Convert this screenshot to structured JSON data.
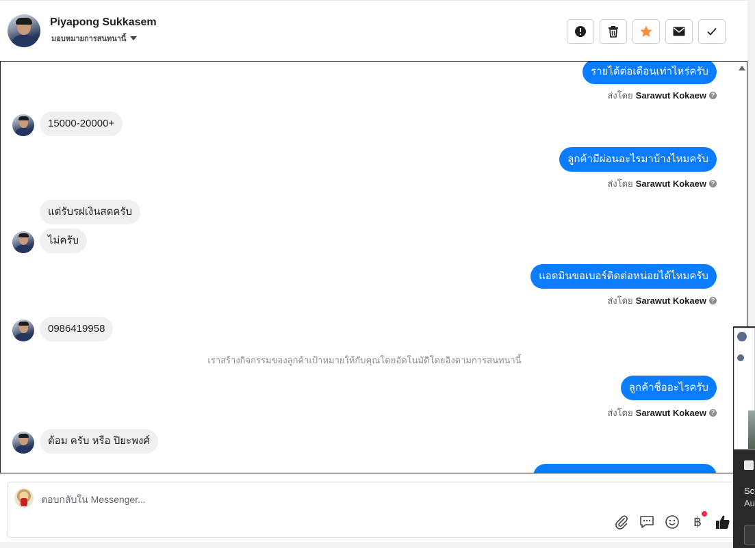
{
  "header": {
    "contact_name": "Piyapong Sukkasem",
    "assign_label": "มอบหมายการสนทนานี้",
    "buttons": [
      {
        "name": "report-button",
        "icon": "exclamation-circle-icon"
      },
      {
        "name": "delete-button",
        "icon": "trash-icon"
      },
      {
        "name": "star-button",
        "icon": "star-icon",
        "color": "#f7923a"
      },
      {
        "name": "mark-unread-button",
        "icon": "envelope-icon"
      },
      {
        "name": "done-button",
        "icon": "checkmark-icon"
      }
    ]
  },
  "conversation": {
    "sent_by_prefix": "ส่งโดย",
    "messages": [
      {
        "dir": "out",
        "text": "รายได้ต่อเดือนเท่าไหร่ครับ",
        "sender": "Sarawut Kokaew"
      },
      {
        "dir": "in",
        "text": "15000-20000+"
      },
      {
        "dir": "out",
        "text": "ลูกค้ามีผ่อนอะไรมาบ้างไหมครับ",
        "sender": "Sarawut Kokaew"
      },
      {
        "dir": "in",
        "text": "แต่รับรฝเงินสดครับ"
      },
      {
        "dir": "in",
        "text": "ไม่ครับ"
      },
      {
        "dir": "out",
        "text": "แอดมินขอเบอร์ติดต่อหน่อยได้ไหมครับ",
        "sender": "Sarawut Kokaew"
      },
      {
        "dir": "in",
        "text": "0986419958"
      },
      {
        "dir": "out",
        "text": "ลูกค้าชื่ออะไรครับ",
        "sender": "Sarawut Kokaew"
      },
      {
        "dir": "in",
        "text": "ต้อม ครับ หรือ ปิยะพงศ์"
      }
    ],
    "system_note": "เราสร้างกิจกรรมของลูกค้าเป้าหมายให้กับคุณโดยอัตโนมัติโดยอิงตามการสนทนานี้"
  },
  "composer": {
    "placeholder": "ตอบกลับใน Messenger...",
    "icons": [
      "paperclip-icon",
      "saved-replies-icon",
      "emoji-icon",
      "baht-payment-icon",
      "thumbs-up-icon"
    ]
  },
  "side_panel": {
    "text1": "Sc",
    "text2": "Au"
  },
  "colors": {
    "outgoing_bubble": "#0a7cff",
    "incoming_bubble": "#f0f0f0",
    "star": "#f7923a"
  }
}
